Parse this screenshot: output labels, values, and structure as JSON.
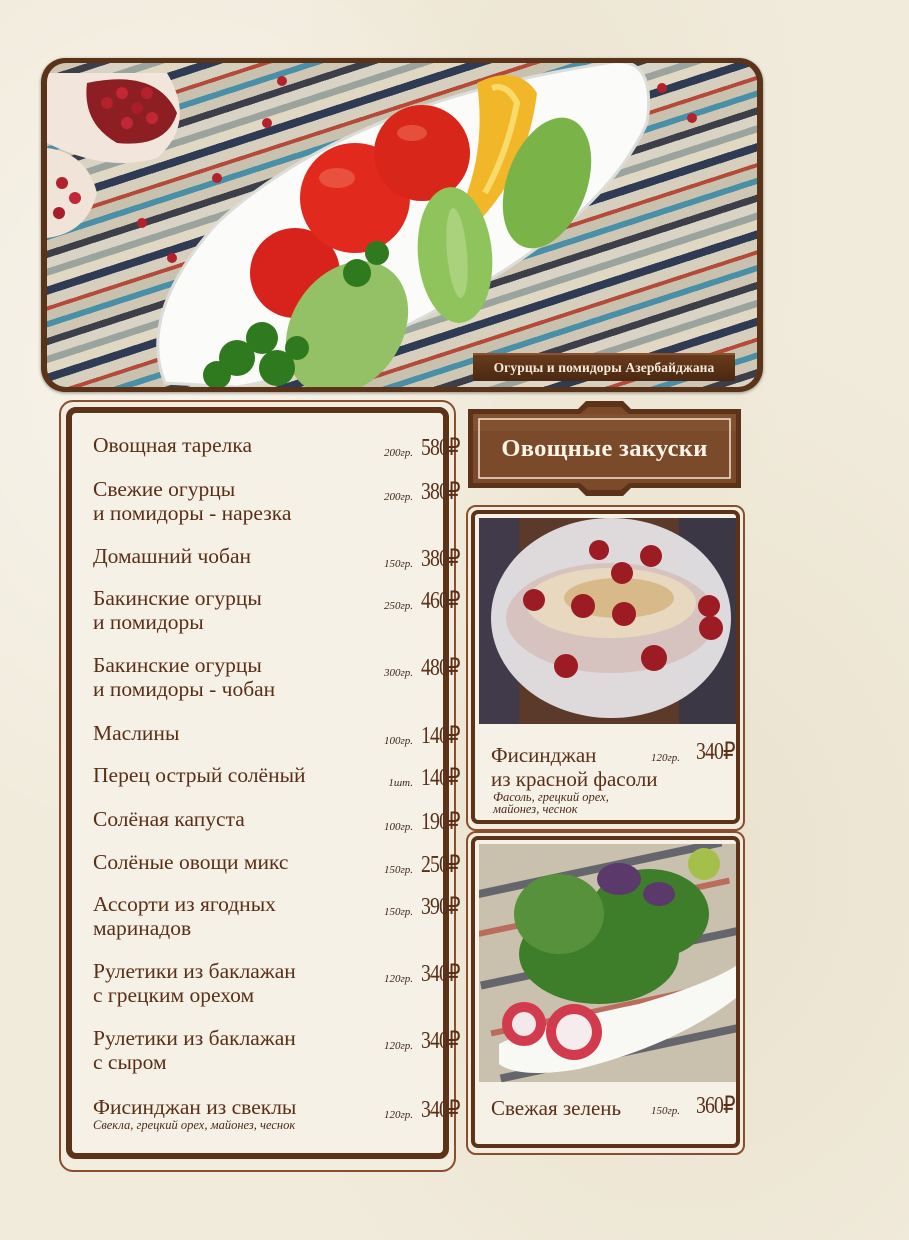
{
  "hero": {
    "caption": "Огурцы и помидоры Азербайджана",
    "photo_icon": "vegetable-platter-photo"
  },
  "section_title": "Овощные закуски",
  "menu": {
    "items": [
      {
        "name": "Овощная тарелка",
        "weight": "200гр.",
        "price": "580₽"
      },
      {
        "name": "Свежие огурцы\nи помидоры - нарезка",
        "weight": "200гр.",
        "price": "380₽"
      },
      {
        "name": "Домашний чобан",
        "weight": "150гр.",
        "price": "380₽"
      },
      {
        "name": "Бакинские огурцы\nи помидоры",
        "weight": "250гр.",
        "price": "460₽"
      },
      {
        "name": "Бакинские огурцы\nи помидоры - чобан",
        "weight": "300гр.",
        "price": "480₽"
      },
      {
        "name": "Маслины",
        "weight": "100гр.",
        "price": "140₽"
      },
      {
        "name": "Перец острый солёный",
        "weight": "1шт.",
        "price": "140₽"
      },
      {
        "name": "Солёная капуста",
        "weight": "100гр.",
        "price": "190₽"
      },
      {
        "name": "Солёные овощи микс",
        "weight": "150гр.",
        "price": "250₽"
      },
      {
        "name": "Ассорти из ягодных\nмаринадов",
        "weight": "150гр.",
        "price": "390₽"
      },
      {
        "name": "Рулетики из баклажан\nс грецким орехом",
        "weight": "120гр.",
        "price": "340₽"
      },
      {
        "name": "Рулетики из баклажан\nс сыром",
        "weight": "120гр.",
        "price": "340₽"
      },
      {
        "name": "Фисинджан из свеклы",
        "weight": "120гр.",
        "price": "340₽",
        "desc": "Свекла, грецкий орех, майонез, чеснок"
      }
    ]
  },
  "featured": [
    {
      "name": "Фисинджан\nиз красной фасоли",
      "weight": "120гр.",
      "price": "340₽",
      "desc": "Фасоль, грецкий орех,\nмайонез, чеснок",
      "photo_icon": "bean-salad-photo"
    },
    {
      "name": "Свежая зелень",
      "weight": "150гр.",
      "price": "360₽",
      "photo_icon": "fresh-herbs-photo"
    }
  ],
  "colors": {
    "text": "#5a2e17",
    "frame": "#5c3218",
    "paper": "#f6f1e6"
  }
}
